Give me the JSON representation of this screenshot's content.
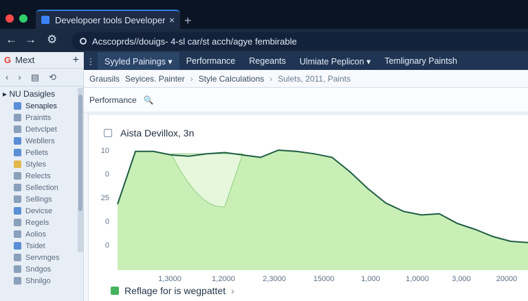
{
  "window": {
    "tab_title": "Developoer tools Developert tt",
    "tab_close": "×",
    "new_tab": "+"
  },
  "address": {
    "url": "Acscoprds//douigs- 4-sl car/st acch/agye fembirable",
    "back": "←",
    "forward": "→",
    "settings": "⚙"
  },
  "sidebar": {
    "header": "Mext",
    "add": "+",
    "tools": [
      "‹",
      "›",
      "▤",
      "⟲"
    ],
    "root": "NU Dasigles",
    "items": [
      {
        "label": "Senaples",
        "icon": "blue"
      },
      {
        "label": "Praintts",
        "icon": "dark"
      },
      {
        "label": "Detvclpet",
        "icon": "dark"
      },
      {
        "label": "Webllers",
        "icon": "blue"
      },
      {
        "label": "Pellets",
        "icon": "blue"
      },
      {
        "label": "Styles",
        "icon": "yellow"
      },
      {
        "label": "Relects",
        "icon": "dark"
      },
      {
        "label": "Sellection",
        "icon": "dark"
      },
      {
        "label": "Sellings",
        "icon": "dark"
      },
      {
        "label": "Devicse",
        "icon": "blue"
      },
      {
        "label": "Regels",
        "icon": "dark"
      },
      {
        "label": "Aolios",
        "icon": "dark"
      },
      {
        "label": "Tsidet",
        "icon": "blue"
      },
      {
        "label": "Servmges",
        "icon": "dark"
      },
      {
        "label": "Sndgos",
        "icon": "dark"
      },
      {
        "label": "Shnilgo",
        "icon": "dark"
      }
    ]
  },
  "panel_tabs": {
    "more": "⋮",
    "tabs": [
      "Syyled Painings ▾",
      "Performance",
      "Regeants",
      "Ulmiate Peplicon ▾",
      "Temlignary Paintsh"
    ],
    "selected": 0
  },
  "breadcrumbs": {
    "items": [
      "Grausils",
      "Seyices. Painter",
      "Style Calculations",
      "Sulets, 2011, Paints"
    ],
    "separator": "›"
  },
  "performance": {
    "label": "Performance",
    "search_icon": "🔍"
  },
  "chart_card": {
    "checkbox_label": "Aista Devillox, 3n",
    "legend_label": "Reflage for is wegpattet",
    "legend_chevron": "›"
  },
  "chart_data": {
    "type": "area",
    "title": "Aista Devillox, 3n",
    "y_ticks": [
      "10",
      "0",
      "25",
      "0",
      "0"
    ],
    "x_ticks": [
      "1,3000",
      "1,2000",
      "2,3000",
      "15000",
      "1,000",
      "1,0000",
      "3,000",
      "20000"
    ],
    "series": [
      {
        "name": "Reflage for is wegpattet",
        "values": [
          0.55,
          0.99,
          0.99,
          0.96,
          0.95,
          0.97,
          0.98,
          0.96,
          0.94,
          1.0,
          0.99,
          0.97,
          0.94,
          0.82,
          0.68,
          0.56,
          0.49,
          0.46,
          0.47,
          0.39,
          0.34,
          0.28,
          0.24,
          0.23
        ]
      }
    ],
    "dip": [
      0.97,
      0.62,
      0.53,
      0.97
    ],
    "color": "#44b35e",
    "fill": "#c9efb7",
    "line": "#1f5c43"
  }
}
